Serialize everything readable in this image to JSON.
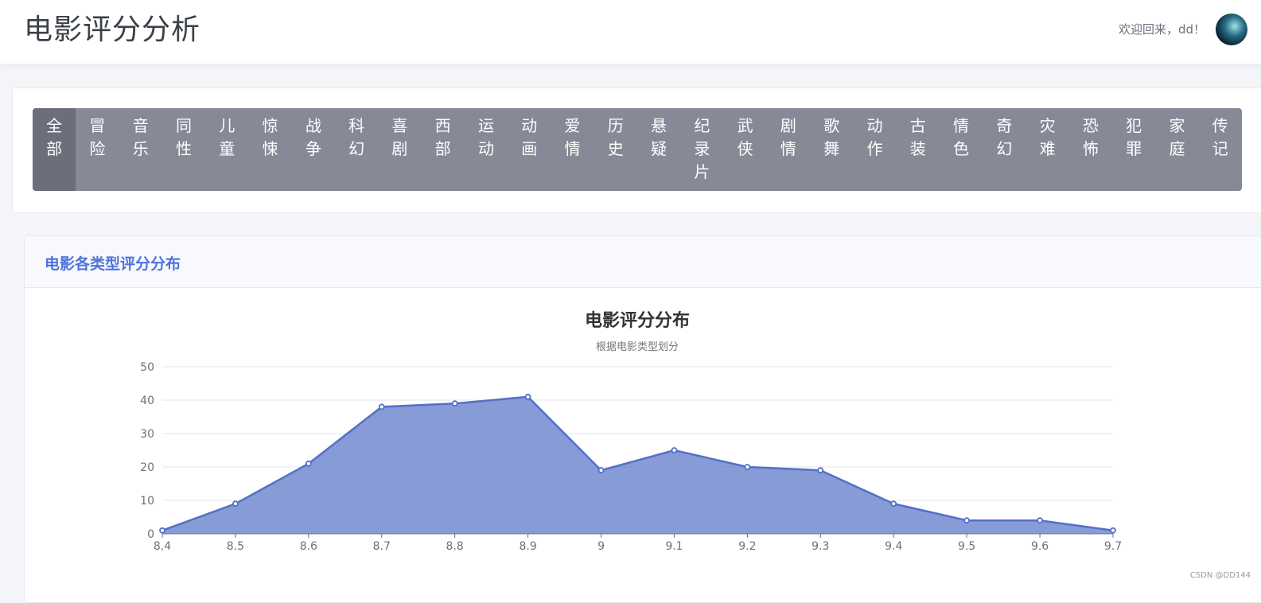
{
  "header": {
    "title": "电影评分分析",
    "welcome": "欢迎回来，dd！"
  },
  "genres": [
    "全部",
    "冒险",
    "音乐",
    "同性",
    "儿童",
    "惊悚",
    "战争",
    "科幻",
    "喜剧",
    "西部",
    "运动",
    "动画",
    "爱情",
    "历史",
    "悬疑",
    "纪录片",
    "武侠",
    "剧情",
    "歌舞",
    "动作",
    "古装",
    "情色",
    "奇幻",
    "灾难",
    "恐怖",
    "犯罪",
    "家庭",
    "传记"
  ],
  "active_genre": "全部",
  "panel": {
    "title": "电影各类型评分分布"
  },
  "chart_data": {
    "type": "area",
    "title": "电影评分分布",
    "subtitle": "根据电影类型划分",
    "xlabel": "",
    "ylabel": "",
    "x": [
      "8.4",
      "8.5",
      "8.6",
      "8.7",
      "8.8",
      "8.9",
      "9",
      "9.1",
      "9.2",
      "9.3",
      "9.4",
      "9.5",
      "9.6",
      "9.7"
    ],
    "values": [
      1,
      9,
      21,
      38,
      39,
      41,
      19,
      25,
      20,
      19,
      9,
      4,
      4,
      1
    ],
    "ylim": [
      0,
      50
    ],
    "yticks": [
      0,
      10,
      20,
      30,
      40,
      50
    ],
    "grid": true,
    "colors": {
      "line": "#5470c6",
      "fill": "#5470c6"
    }
  },
  "watermark": "CSDN @DD144"
}
